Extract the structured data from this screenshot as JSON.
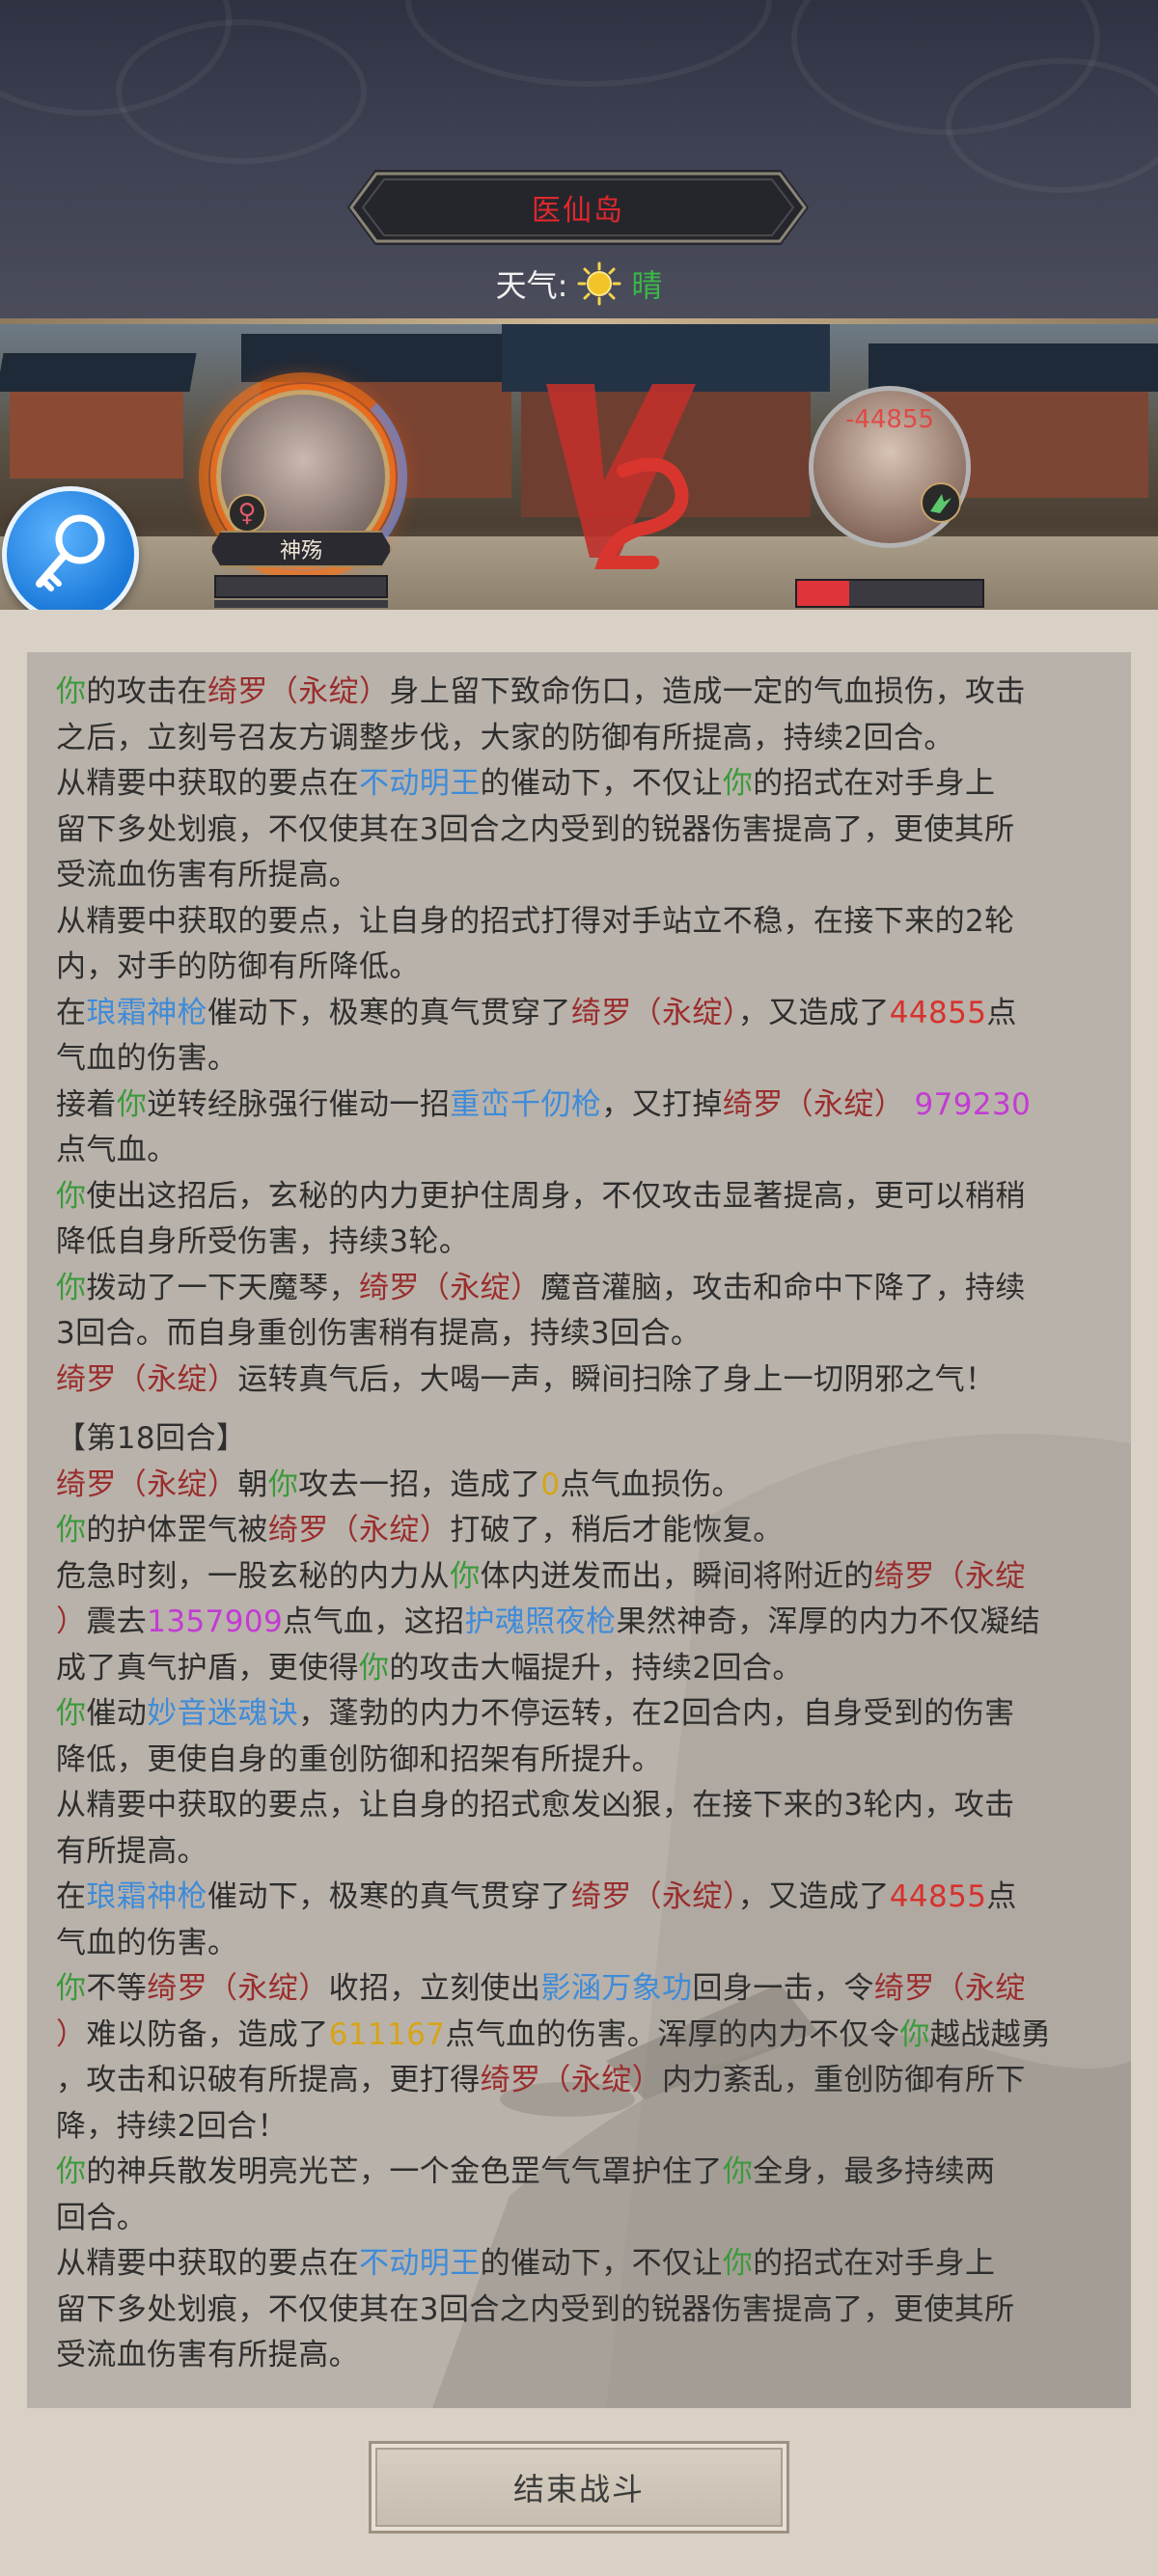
{
  "header": {
    "location": "医仙岛",
    "weather_label": "天气:",
    "weather_value": "晴",
    "weather_icon": "sun-icon"
  },
  "battle": {
    "player": {
      "name": "神殇",
      "gender_icon": "female-icon",
      "hp_fraction": 0
    },
    "enemy": {
      "floating_damage": "-44855",
      "hp_fraction": 0.28
    },
    "vs_label": "VS",
    "search_icon": "magnifier-key-icon"
  },
  "log": {
    "lines": [
      [
        {
          "t": "你",
          "c": "you"
        },
        {
          "t": "的攻击在",
          "c": "dark"
        },
        {
          "t": "绮罗（永绽）",
          "c": "foe"
        },
        {
          "t": "身上留下致命伤口，造成一定的气血损伤，攻击",
          "c": "dark"
        }
      ],
      [
        {
          "t": "之后，立刻号召友方调整步伐，大家的防御有所提高，持续2回合。",
          "c": "dark"
        }
      ],
      [
        {
          "t": "从精要中获取的要点在",
          "c": "dark"
        },
        {
          "t": "不动明王",
          "c": "skill"
        },
        {
          "t": "的催动下，不仅让",
          "c": "dark"
        },
        {
          "t": "你",
          "c": "you"
        },
        {
          "t": "的招式在对手身上",
          "c": "dark"
        }
      ],
      [
        {
          "t": "留下多处划痕，不仅使其在3回合之内受到的锐器伤害提高了，更使其所",
          "c": "dark"
        }
      ],
      [
        {
          "t": "受流血伤害有所提高。",
          "c": "dark"
        }
      ],
      [
        {
          "t": "从精要中获取的要点，让自身的招式打得对手站立不稳，在接下来的2轮",
          "c": "dark"
        }
      ],
      [
        {
          "t": "内，对手的防御有所降低。",
          "c": "dark"
        }
      ],
      [
        {
          "t": "在",
          "c": "dark"
        },
        {
          "t": "琅霜神枪",
          "c": "skill"
        },
        {
          "t": "催动下，极寒的真气贯穿了",
          "c": "dark"
        },
        {
          "t": "绮罗（永绽）",
          "c": "foe"
        },
        {
          "t": "，又造成了",
          "c": "dark"
        },
        {
          "t": "44855",
          "c": "dmg"
        },
        {
          "t": "点",
          "c": "dark"
        }
      ],
      [
        {
          "t": "气血的伤害。",
          "c": "dark"
        }
      ],
      [
        {
          "t": "接着",
          "c": "dark"
        },
        {
          "t": "你",
          "c": "you"
        },
        {
          "t": "逆转经脉强行催动一招",
          "c": "dark"
        },
        {
          "t": "重峦千仞枪",
          "c": "skill"
        },
        {
          "t": "，又打掉",
          "c": "dark"
        },
        {
          "t": "绮罗（永绽）",
          "c": "foe"
        },
        {
          "t": " 979230",
          "c": "mag"
        }
      ],
      [
        {
          "t": "点气血。",
          "c": "dark"
        }
      ],
      [
        {
          "t": "你",
          "c": "you"
        },
        {
          "t": "使出这招后，玄秘的内力更护住周身，不仅攻击显著提高，更可以稍稍",
          "c": "dark"
        }
      ],
      [
        {
          "t": "降低自身所受伤害，持续3轮。",
          "c": "dark"
        }
      ],
      [
        {
          "t": "你",
          "c": "you"
        },
        {
          "t": "拨动了一下天魔琴，",
          "c": "dark"
        },
        {
          "t": "绮罗（永绽）",
          "c": "foe"
        },
        {
          "t": "魔音灌脑，攻击和命中下降了，持续",
          "c": "dark"
        }
      ],
      [
        {
          "t": "3回合。而自身重创伤害稍有提高，持续3回合。",
          "c": "dark"
        }
      ],
      [
        {
          "t": "绮罗（永绽）",
          "c": "foe"
        },
        {
          "t": "运转真气后，大喝一声，瞬间扫除了身上一切阴邪之气！",
          "c": "dark"
        }
      ],
      "gap",
      [
        {
          "t": "【第18回合】",
          "c": "dark"
        }
      ],
      [
        {
          "t": "绮罗（永绽）",
          "c": "foe"
        },
        {
          "t": "朝",
          "c": "dark"
        },
        {
          "t": "你",
          "c": "you"
        },
        {
          "t": "攻去一招，造成了",
          "c": "dark"
        },
        {
          "t": "0",
          "c": "gold"
        },
        {
          "t": "点气血损伤。",
          "c": "dark"
        }
      ],
      [
        {
          "t": "你",
          "c": "you"
        },
        {
          "t": "的护体罡气被",
          "c": "dark"
        },
        {
          "t": "绮罗（永绽）",
          "c": "foe"
        },
        {
          "t": "打破了，稍后才能恢复。",
          "c": "dark"
        }
      ],
      [
        {
          "t": "危急时刻，一股玄秘的内力从",
          "c": "dark"
        },
        {
          "t": "你",
          "c": "you"
        },
        {
          "t": "体内迸发而出，瞬间将附近的",
          "c": "dark"
        },
        {
          "t": "绮罗（永绽",
          "c": "foe"
        }
      ],
      [
        {
          "t": "）",
          "c": "foe"
        },
        {
          "t": "震去",
          "c": "dark"
        },
        {
          "t": "1357909",
          "c": "mag"
        },
        {
          "t": "点气血，这招",
          "c": "dark"
        },
        {
          "t": "护魂照夜枪",
          "c": "skill"
        },
        {
          "t": "果然神奇，浑厚的内力不仅凝结",
          "c": "dark"
        }
      ],
      [
        {
          "t": "成了真气护盾，更使得",
          "c": "dark"
        },
        {
          "t": "你",
          "c": "you"
        },
        {
          "t": "的攻击大幅提升，持续2回合。",
          "c": "dark"
        }
      ],
      [
        {
          "t": "你",
          "c": "you"
        },
        {
          "t": "催动",
          "c": "dark"
        },
        {
          "t": "妙音迷魂诀",
          "c": "skill"
        },
        {
          "t": "，蓬勃的内力不停运转，在2回合内，自身受到的伤害",
          "c": "dark"
        }
      ],
      [
        {
          "t": "降低，更使自身的重创防御和招架有所提升。",
          "c": "dark"
        }
      ],
      [
        {
          "t": "从精要中获取的要点，让自身的招式愈发凶狠，在接下来的3轮内，攻击",
          "c": "dark"
        }
      ],
      [
        {
          "t": "有所提高。",
          "c": "dark"
        }
      ],
      [
        {
          "t": "在",
          "c": "dark"
        },
        {
          "t": "琅霜神枪",
          "c": "skill"
        },
        {
          "t": "催动下，极寒的真气贯穿了",
          "c": "dark"
        },
        {
          "t": "绮罗（永绽）",
          "c": "foe"
        },
        {
          "t": "，又造成了",
          "c": "dark"
        },
        {
          "t": "44855",
          "c": "dmg"
        },
        {
          "t": "点",
          "c": "dark"
        }
      ],
      [
        {
          "t": "气血的伤害。",
          "c": "dark"
        }
      ],
      [
        {
          "t": "你",
          "c": "you"
        },
        {
          "t": "不等",
          "c": "dark"
        },
        {
          "t": "绮罗（永绽）",
          "c": "foe"
        },
        {
          "t": "收招，立刻使出",
          "c": "dark"
        },
        {
          "t": "影涵万象功",
          "c": "skill"
        },
        {
          "t": "回身一击，令",
          "c": "dark"
        },
        {
          "t": "绮罗（永绽",
          "c": "foe"
        }
      ],
      [
        {
          "t": "）",
          "c": "foe"
        },
        {
          "t": "难以防备，造成了",
          "c": "dark"
        },
        {
          "t": "611167",
          "c": "gold"
        },
        {
          "t": "点气血的伤害。浑厚的内力不仅令",
          "c": "dark"
        },
        {
          "t": "你",
          "c": "you"
        },
        {
          "t": "越战越勇",
          "c": "dark"
        }
      ],
      [
        {
          "t": "，攻击和识破有所提高，更打得",
          "c": "dark"
        },
        {
          "t": "绮罗（永绽）",
          "c": "foe"
        },
        {
          "t": "内力紊乱，重创防御有所下",
          "c": "dark"
        }
      ],
      [
        {
          "t": "降，持续2回合！",
          "c": "dark"
        }
      ],
      [
        {
          "t": "你",
          "c": "you"
        },
        {
          "t": "的神兵散发明亮光芒，一个金色罡气气罩护住了",
          "c": "dark"
        },
        {
          "t": "你",
          "c": "you"
        },
        {
          "t": "全身，最多持续两",
          "c": "dark"
        }
      ],
      [
        {
          "t": "回合。",
          "c": "dark"
        }
      ],
      [
        {
          "t": "从精要中获取的要点在",
          "c": "dark"
        },
        {
          "t": "不动明王",
          "c": "skill"
        },
        {
          "t": "的催动下，不仅让",
          "c": "dark"
        },
        {
          "t": "你",
          "c": "you"
        },
        {
          "t": "的招式在对手身上",
          "c": "dark"
        }
      ],
      [
        {
          "t": "留下多处划痕，不仅使其在3回合之内受到的锐器伤害提高了，更使其所",
          "c": "dark"
        }
      ],
      [
        {
          "t": "受流血伤害有所提高。",
          "c": "dark"
        }
      ]
    ]
  },
  "footer": {
    "end_battle_label": "结束战斗"
  },
  "colors": {
    "you": "#3b9a3b",
    "foe": "#9a2d2d",
    "skill": "#3f8bd8",
    "damage": "#d6322d",
    "magenta": "#c23bd4",
    "gold": "#d6a418",
    "location": "#e0282d"
  }
}
